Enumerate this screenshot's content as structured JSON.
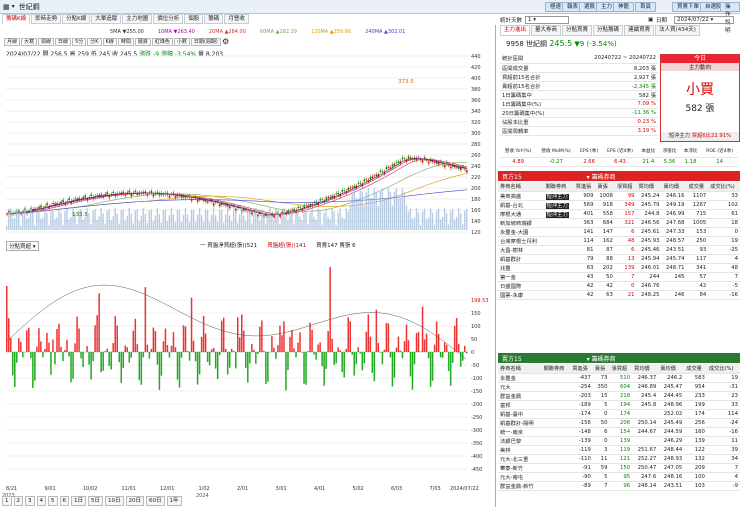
{
  "window": {
    "title": "世紀鋼",
    "menu_icon": "chart-icon"
  },
  "header_buttons": [
    "極速",
    "報表",
    "選股",
    "主力",
    "神龍",
    "首頁",
    "買賣下單",
    "自選股",
    "操作說明"
  ],
  "tools": [
    "籌碼K線",
    "即時走勢",
    "分點K線",
    "大單追蹤",
    "主力地圖",
    "價位分析",
    "個股",
    "籌碼",
    "月營收"
  ],
  "chart_subtools": [
    "月線",
    "大寫",
    "週線",
    "日線",
    "5分",
    "分K",
    "K線",
    "時間",
    "融資",
    "紅綠色",
    "小數",
    "日期(週期)"
  ],
  "info_line": {
    "date": "2024/07/22",
    "open": "開 256.5",
    "high": "高 259",
    "low": "低 245",
    "close": "收 245.5",
    "change": "漲跌 -9",
    "pct": "漲幅 -3.54%",
    "vol": "量 8,203"
  },
  "ma_legend": [
    "5MA ▼255.00",
    "10MA ▼263.40",
    "20MA ▲284.00",
    "60MA ▲282.29",
    "120MA ▲259.66",
    "240MA ▲302.01"
  ],
  "price_labels": [
    "373.5",
    "133.5"
  ],
  "price_axis": [
    "440",
    "420",
    "400",
    "380",
    "360",
    "340",
    "320",
    "300",
    "280",
    "260",
    "240",
    "220",
    "200",
    "180",
    "160",
    "140",
    "120"
  ],
  "lower_indicator": {
    "selector": "分點買超",
    "legend": "一 買盤淨買超(張)(521",
    "legend2": "買盤超(張)(141",
    "legend3": "買賣147 賣張 6"
  },
  "lower_axis": [
    "199.53",
    "150",
    "100",
    "50",
    "0",
    "-50",
    "-100",
    "-150",
    "-200",
    "-250",
    "-300",
    "-350",
    "-400",
    "-450"
  ],
  "lower_label": "199.53",
  "date_labels": [
    "8/21",
    "9/01",
    "10/02",
    "11/01",
    "12/01",
    "1/02",
    "2/01",
    "3/01",
    "4/01",
    "5/02",
    "6/03",
    "7/03",
    "2024/07/22"
  ],
  "year_labels": [
    "2023",
    "2024"
  ],
  "bottom_bar": [
    "1",
    "2",
    "3",
    "4",
    "5",
    "6",
    "1日",
    "5日",
    "10日",
    "20日",
    "60日",
    "1年"
  ],
  "right": {
    "stat_label": "統計天數",
    "stat_value": "1",
    "date_label": "日期",
    "date_value": "2024/07/22",
    "stock_code": "9958 世紀鋼",
    "price": "245.5",
    "change": "▼9 (-3.54%)",
    "tabs": [
      "主力進出",
      "量大券商",
      "分點買賣",
      "分點籌碼",
      "連續買賣",
      "法人買(434天)"
    ],
    "summary": [
      [
        "統計區間",
        "20240722 ~ 20240722"
      ],
      [
        "區間成交量",
        "8,203 張"
      ],
      [
        "買超前15名合計",
        "2,927 張"
      ],
      [
        "賣超前15名合計",
        "-2,345 張"
      ],
      [
        "1日籌碼集中",
        "582 張"
      ],
      [
        "1日籌碼集中(%)",
        "7.09 %"
      ],
      [
        "20日籌碼集中(%)",
        "-11.36 %"
      ],
      [
        "佔股本比重",
        "0.23 %"
      ],
      [
        "區間周轉率",
        "3.19 %"
      ]
    ],
    "today_box": {
      "head": "今日",
      "sub": "主力動向",
      "label": "小買",
      "value": "582 張",
      "footer_label": "短沖主力",
      "footer_value": "買超6比22.91%"
    },
    "metrics_head": [
      "營收 YoY(%)",
      "營收 MoM(%)",
      "EPS (季)",
      "EPS (近4季)",
      "本益比",
      "淨值比",
      "本淨比",
      "ROE (近4季)"
    ],
    "metrics": [
      "4.89",
      "-0.27",
      "2.66",
      "6.43",
      "21.4",
      "5.36",
      "1.18",
      "14"
    ],
    "buy_title": "買方15",
    "buy_sel": "籌碼券商",
    "buy_cols": [
      "券商名稱",
      "關聯券商",
      "買進張",
      "賣張",
      "淨買超",
      "買均價",
      "賣均價",
      "成交量",
      "成交比(%)"
    ],
    "buy_rows": [
      [
        "美商高盛",
        "短沖主力",
        "909",
        "1008",
        "99",
        "245.24",
        "246.16",
        "1107",
        "33"
      ],
      [
        "凱基-台北",
        "短沖主力",
        "569",
        "918",
        "349",
        "245.79",
        "249.19",
        "1267",
        "102"
      ],
      [
        "摩根大通",
        "短沖主力",
        "401",
        "558",
        "157",
        "244.8",
        "246.99",
        "715",
        "61"
      ],
      [
        "新加坡商瑞銀",
        "",
        "363",
        "684",
        "321",
        "246.56",
        "247.68",
        "1005",
        "18"
      ],
      [
        "永豐金-大園",
        "",
        "141",
        "147",
        "6",
        "245.61",
        "247.33",
        "153",
        "0"
      ],
      [
        "台灣摩根士丹利",
        "",
        "114",
        "162",
        "48",
        "245.93",
        "248.57",
        "250",
        "19"
      ],
      [
        "大昌-樹林",
        "",
        "81",
        "87",
        "6",
        "245.46",
        "243.51",
        "93",
        "-25"
      ],
      [
        "凱基群計",
        "",
        "79",
        "88",
        "13",
        "245.94",
        "245.74",
        "117",
        "4"
      ],
      [
        "兆豐",
        "",
        "63",
        "202",
        "139",
        "246.01",
        "248.71",
        "341",
        "48"
      ],
      [
        "第一金",
        "",
        "43",
        "50",
        "7",
        "244",
        "245",
        "57",
        "7"
      ],
      [
        "日盛國際",
        "",
        "42",
        "42",
        "0",
        "246.76",
        "",
        "42",
        "-5"
      ],
      [
        "國票-永康",
        "",
        "42",
        "63",
        "21",
        "248.25",
        "246",
        "84",
        "-16"
      ]
    ],
    "sell_title": "賣方15",
    "sell_sel": "籌碼券商",
    "sell_rows": [
      [
        "永豐金",
        "",
        "-437",
        "73",
        "510",
        "246.37",
        "246.2",
        "583",
        "19"
      ],
      [
        "元大",
        "",
        "-254",
        "350",
        "604",
        "246.89",
        "245.47",
        "954",
        "-31"
      ],
      [
        "群益金鼎",
        "",
        "-203",
        "15",
        "218",
        "245.4",
        "244.45",
        "233",
        "23"
      ],
      [
        "富邦",
        "",
        "-189",
        "5",
        "194",
        "245.8",
        "248.96",
        "199",
        "33"
      ],
      [
        "凱基-臺中",
        "",
        "-174",
        "0",
        "174",
        "",
        "252.02",
        "174",
        "114"
      ],
      [
        "凱基群計-陽明",
        "",
        "-156",
        "50",
        "206",
        "250.14",
        "245.49",
        "256",
        "-24"
      ],
      [
        "統一-南京",
        "",
        "-148",
        "6",
        "154",
        "244.67",
        "244.59",
        "160",
        "-16"
      ],
      [
        "法銀巴黎",
        "",
        "-139",
        "0",
        "139",
        "",
        "246.29",
        "139",
        "11"
      ],
      [
        "美林",
        "",
        "-119",
        "3",
        "119",
        "251.67",
        "248.44",
        "122",
        "39"
      ],
      [
        "元大-北三重",
        "",
        "-110",
        "11",
        "121",
        "252.27",
        "248.93",
        "132",
        "34"
      ],
      [
        "華泰-新竹",
        "",
        "-91",
        "59",
        "150",
        "250.47",
        "247.05",
        "209",
        "7"
      ],
      [
        "元大-南屯",
        "",
        "-90",
        "5",
        "95",
        "247.6",
        "248.16",
        "100",
        "4"
      ],
      [
        "群益金鼎-新竹",
        "",
        "-89",
        "7",
        "96",
        "248.14",
        "243.51",
        "103",
        "-9"
      ]
    ],
    "colors": {
      "up": "#dd0000",
      "down": "#008800",
      "accent": "#cc2222"
    }
  }
}
